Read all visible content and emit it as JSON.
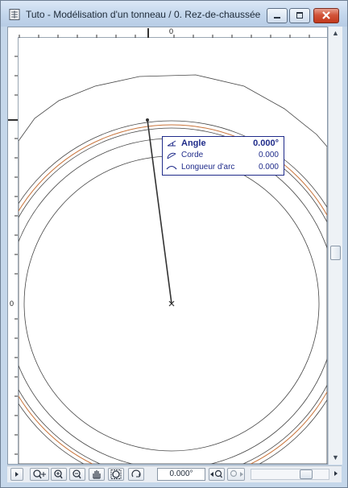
{
  "window": {
    "title": "Tuto - Modélisation d'un tonneau / 0. Rez-de-chaussée",
    "icon": "document-grid-icon"
  },
  "rulers": {
    "top_zero_label": "0",
    "left_zero_label": "0"
  },
  "readout": {
    "rows": [
      {
        "label": "Angle",
        "value": "0.000°",
        "icon": "angle-icon"
      },
      {
        "label": "Corde",
        "value": "0.000",
        "icon": "chord-icon"
      },
      {
        "label": "Longueur d'arc",
        "value": "0.000",
        "icon": "arc-length-icon"
      }
    ],
    "text_color": "#1f2b8a"
  },
  "toolbar": {
    "zoom_value": "0.000°",
    "buttons": [
      {
        "name": "zoom-in-plus-icon"
      },
      {
        "name": "zoom-in-icon"
      },
      {
        "name": "zoom-out-icon"
      },
      {
        "name": "pan-hand-icon"
      },
      {
        "name": "fit-in-window-icon"
      },
      {
        "name": "rotate-view-icon"
      },
      {
        "name": "previous-zoom-icon"
      },
      {
        "name": "next-zoom-icon"
      }
    ]
  },
  "colors": {
    "accent_arc": "#c8733a",
    "line": "#333333"
  }
}
